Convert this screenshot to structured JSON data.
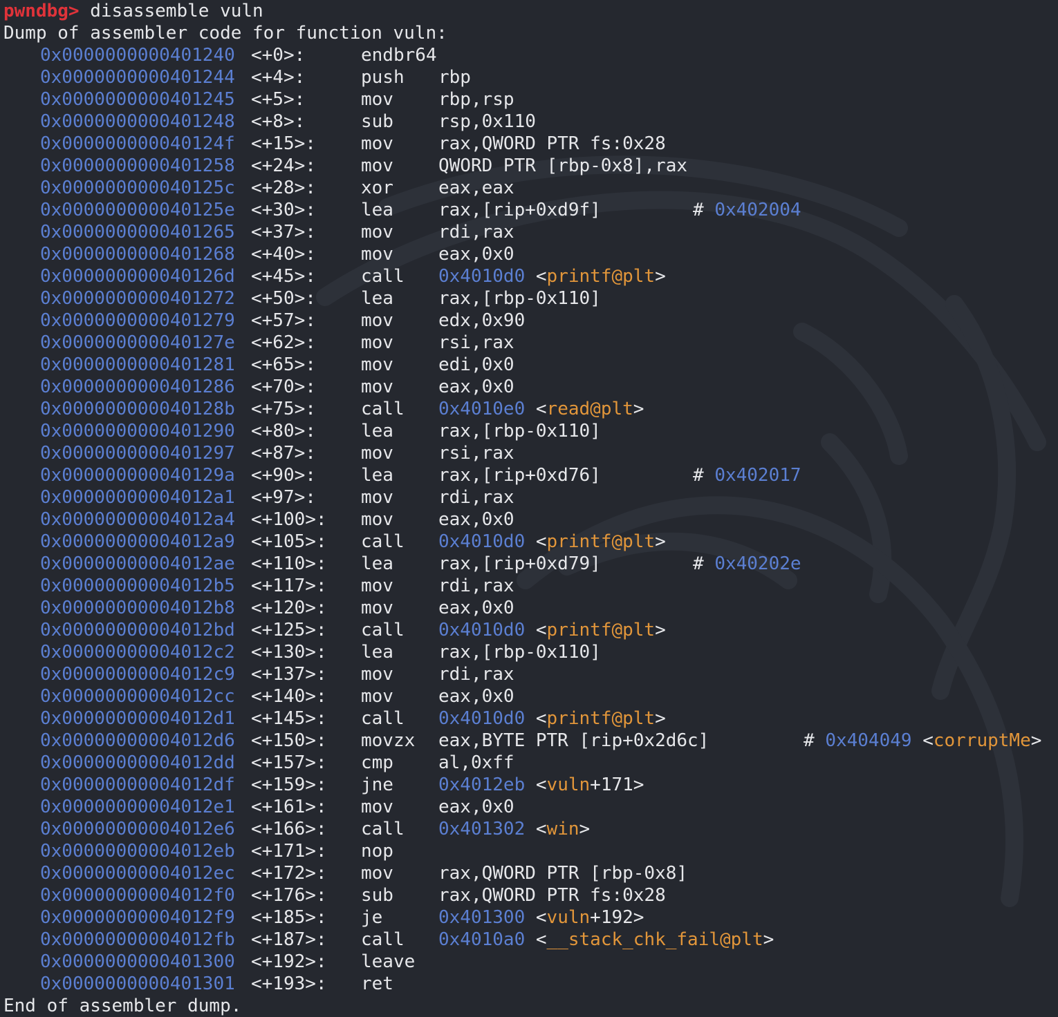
{
  "prompt": "pwndbg>",
  "command": " disassemble vuln",
  "header": "Dump of assembler code for function vuln:",
  "footer": "End of assembler dump.",
  "colors": {
    "background": "#25282f",
    "prompt": "#e0333a",
    "address": "#5b7fd2",
    "symbol": "#e2963a",
    "text": "#e6e7ea"
  },
  "rows": [
    {
      "addr": "0x0000000000401240",
      "off": "<+0>:",
      "mn": "endbr64",
      "ops": ""
    },
    {
      "addr": "0x0000000000401244",
      "off": "<+4>:",
      "mn": "push",
      "ops": "rbp"
    },
    {
      "addr": "0x0000000000401245",
      "off": "<+5>:",
      "mn": "mov",
      "ops": "rbp,rsp"
    },
    {
      "addr": "0x0000000000401248",
      "off": "<+8>:",
      "mn": "sub",
      "ops": "rsp,0x110"
    },
    {
      "addr": "0x000000000040124f",
      "off": "<+15>:",
      "mn": "mov",
      "ops": "rax,QWORD PTR fs:0x28"
    },
    {
      "addr": "0x0000000000401258",
      "off": "<+24>:",
      "mn": "mov",
      "ops": "QWORD PTR [rbp-0x8],rax"
    },
    {
      "addr": "0x000000000040125c",
      "off": "<+28>:",
      "mn": "xor",
      "ops": "eax,eax"
    },
    {
      "addr": "0x000000000040125e",
      "off": "<+30>:",
      "mn": "lea",
      "ops": "rax,[rip+0xd9f]",
      "cmt": "0x402004",
      "cmtx": 997
    },
    {
      "addr": "0x0000000000401265",
      "off": "<+37>:",
      "mn": "mov",
      "ops": "rdi,rax"
    },
    {
      "addr": "0x0000000000401268",
      "off": "<+40>:",
      "mn": "mov",
      "ops": "eax,0x0"
    },
    {
      "addr": "0x000000000040126d",
      "off": "<+45>:",
      "mn": "call",
      "target": "0x4010d0",
      "sym": "printf@plt"
    },
    {
      "addr": "0x0000000000401272",
      "off": "<+50>:",
      "mn": "lea",
      "ops": "rax,[rbp-0x110]"
    },
    {
      "addr": "0x0000000000401279",
      "off": "<+57>:",
      "mn": "mov",
      "ops": "edx,0x90"
    },
    {
      "addr": "0x000000000040127e",
      "off": "<+62>:",
      "mn": "mov",
      "ops": "rsi,rax"
    },
    {
      "addr": "0x0000000000401281",
      "off": "<+65>:",
      "mn": "mov",
      "ops": "edi,0x0"
    },
    {
      "addr": "0x0000000000401286",
      "off": "<+70>:",
      "mn": "mov",
      "ops": "eax,0x0"
    },
    {
      "addr": "0x000000000040128b",
      "off": "<+75>:",
      "mn": "call",
      "target": "0x4010e0",
      "sym": "read@plt"
    },
    {
      "addr": "0x0000000000401290",
      "off": "<+80>:",
      "mn": "lea",
      "ops": "rax,[rbp-0x110]"
    },
    {
      "addr": "0x0000000000401297",
      "off": "<+87>:",
      "mn": "mov",
      "ops": "rsi,rax"
    },
    {
      "addr": "0x000000000040129a",
      "off": "<+90>:",
      "mn": "lea",
      "ops": "rax,[rip+0xd76]",
      "cmt": "0x402017",
      "cmtx": 997
    },
    {
      "addr": "0x00000000004012a1",
      "off": "<+97>:",
      "mn": "mov",
      "ops": "rdi,rax"
    },
    {
      "addr": "0x00000000004012a4",
      "off": "<+100>:",
      "mn": "mov",
      "ops": "eax,0x0"
    },
    {
      "addr": "0x00000000004012a9",
      "off": "<+105>:",
      "mn": "call",
      "target": "0x4010d0",
      "sym": "printf@plt"
    },
    {
      "addr": "0x00000000004012ae",
      "off": "<+110>:",
      "mn": "lea",
      "ops": "rax,[rip+0xd79]",
      "cmt": "0x40202e",
      "cmtx": 997
    },
    {
      "addr": "0x00000000004012b5",
      "off": "<+117>:",
      "mn": "mov",
      "ops": "rdi,rax"
    },
    {
      "addr": "0x00000000004012b8",
      "off": "<+120>:",
      "mn": "mov",
      "ops": "eax,0x0"
    },
    {
      "addr": "0x00000000004012bd",
      "off": "<+125>:",
      "mn": "call",
      "target": "0x4010d0",
      "sym": "printf@plt"
    },
    {
      "addr": "0x00000000004012c2",
      "off": "<+130>:",
      "mn": "lea",
      "ops": "rax,[rbp-0x110]"
    },
    {
      "addr": "0x00000000004012c9",
      "off": "<+137>:",
      "mn": "mov",
      "ops": "rdi,rax"
    },
    {
      "addr": "0x00000000004012cc",
      "off": "<+140>:",
      "mn": "mov",
      "ops": "eax,0x0"
    },
    {
      "addr": "0x00000000004012d1",
      "off": "<+145>:",
      "mn": "call",
      "target": "0x4010d0",
      "sym": "printf@plt"
    },
    {
      "addr": "0x00000000004012d6",
      "off": "<+150>:",
      "mn": "movzx",
      "ops": "eax,BYTE PTR [rip+0x2d6c]",
      "cmt": "0x404049",
      "cmtsym": "corruptMe",
      "cmtx": 1157
    },
    {
      "addr": "0x00000000004012dd",
      "off": "<+157>:",
      "mn": "cmp",
      "ops": "al,0xff"
    },
    {
      "addr": "0x00000000004012df",
      "off": "<+159>:",
      "mn": "jne",
      "target": "0x4012eb",
      "sym": "vuln",
      "symoff": "+171"
    },
    {
      "addr": "0x00000000004012e1",
      "off": "<+161>:",
      "mn": "mov",
      "ops": "eax,0x0"
    },
    {
      "addr": "0x00000000004012e6",
      "off": "<+166>:",
      "mn": "call",
      "target": "0x401302",
      "sym": "win"
    },
    {
      "addr": "0x00000000004012eb",
      "off": "<+171>:",
      "mn": "nop",
      "ops": ""
    },
    {
      "addr": "0x00000000004012ec",
      "off": "<+172>:",
      "mn": "mov",
      "ops": "rax,QWORD PTR [rbp-0x8]"
    },
    {
      "addr": "0x00000000004012f0",
      "off": "<+176>:",
      "mn": "sub",
      "ops": "rax,QWORD PTR fs:0x28"
    },
    {
      "addr": "0x00000000004012f9",
      "off": "<+185>:",
      "mn": "je",
      "target": "0x401300",
      "sym": "vuln",
      "symoff": "+192"
    },
    {
      "addr": "0x00000000004012fb",
      "off": "<+187>:",
      "mn": "call",
      "target": "0x4010a0",
      "sym": "__stack_chk_fail@plt"
    },
    {
      "addr": "0x0000000000401300",
      "off": "<+192>:",
      "mn": "leave",
      "ops": ""
    },
    {
      "addr": "0x0000000000401301",
      "off": "<+193>:",
      "mn": "ret",
      "ops": ""
    }
  ]
}
